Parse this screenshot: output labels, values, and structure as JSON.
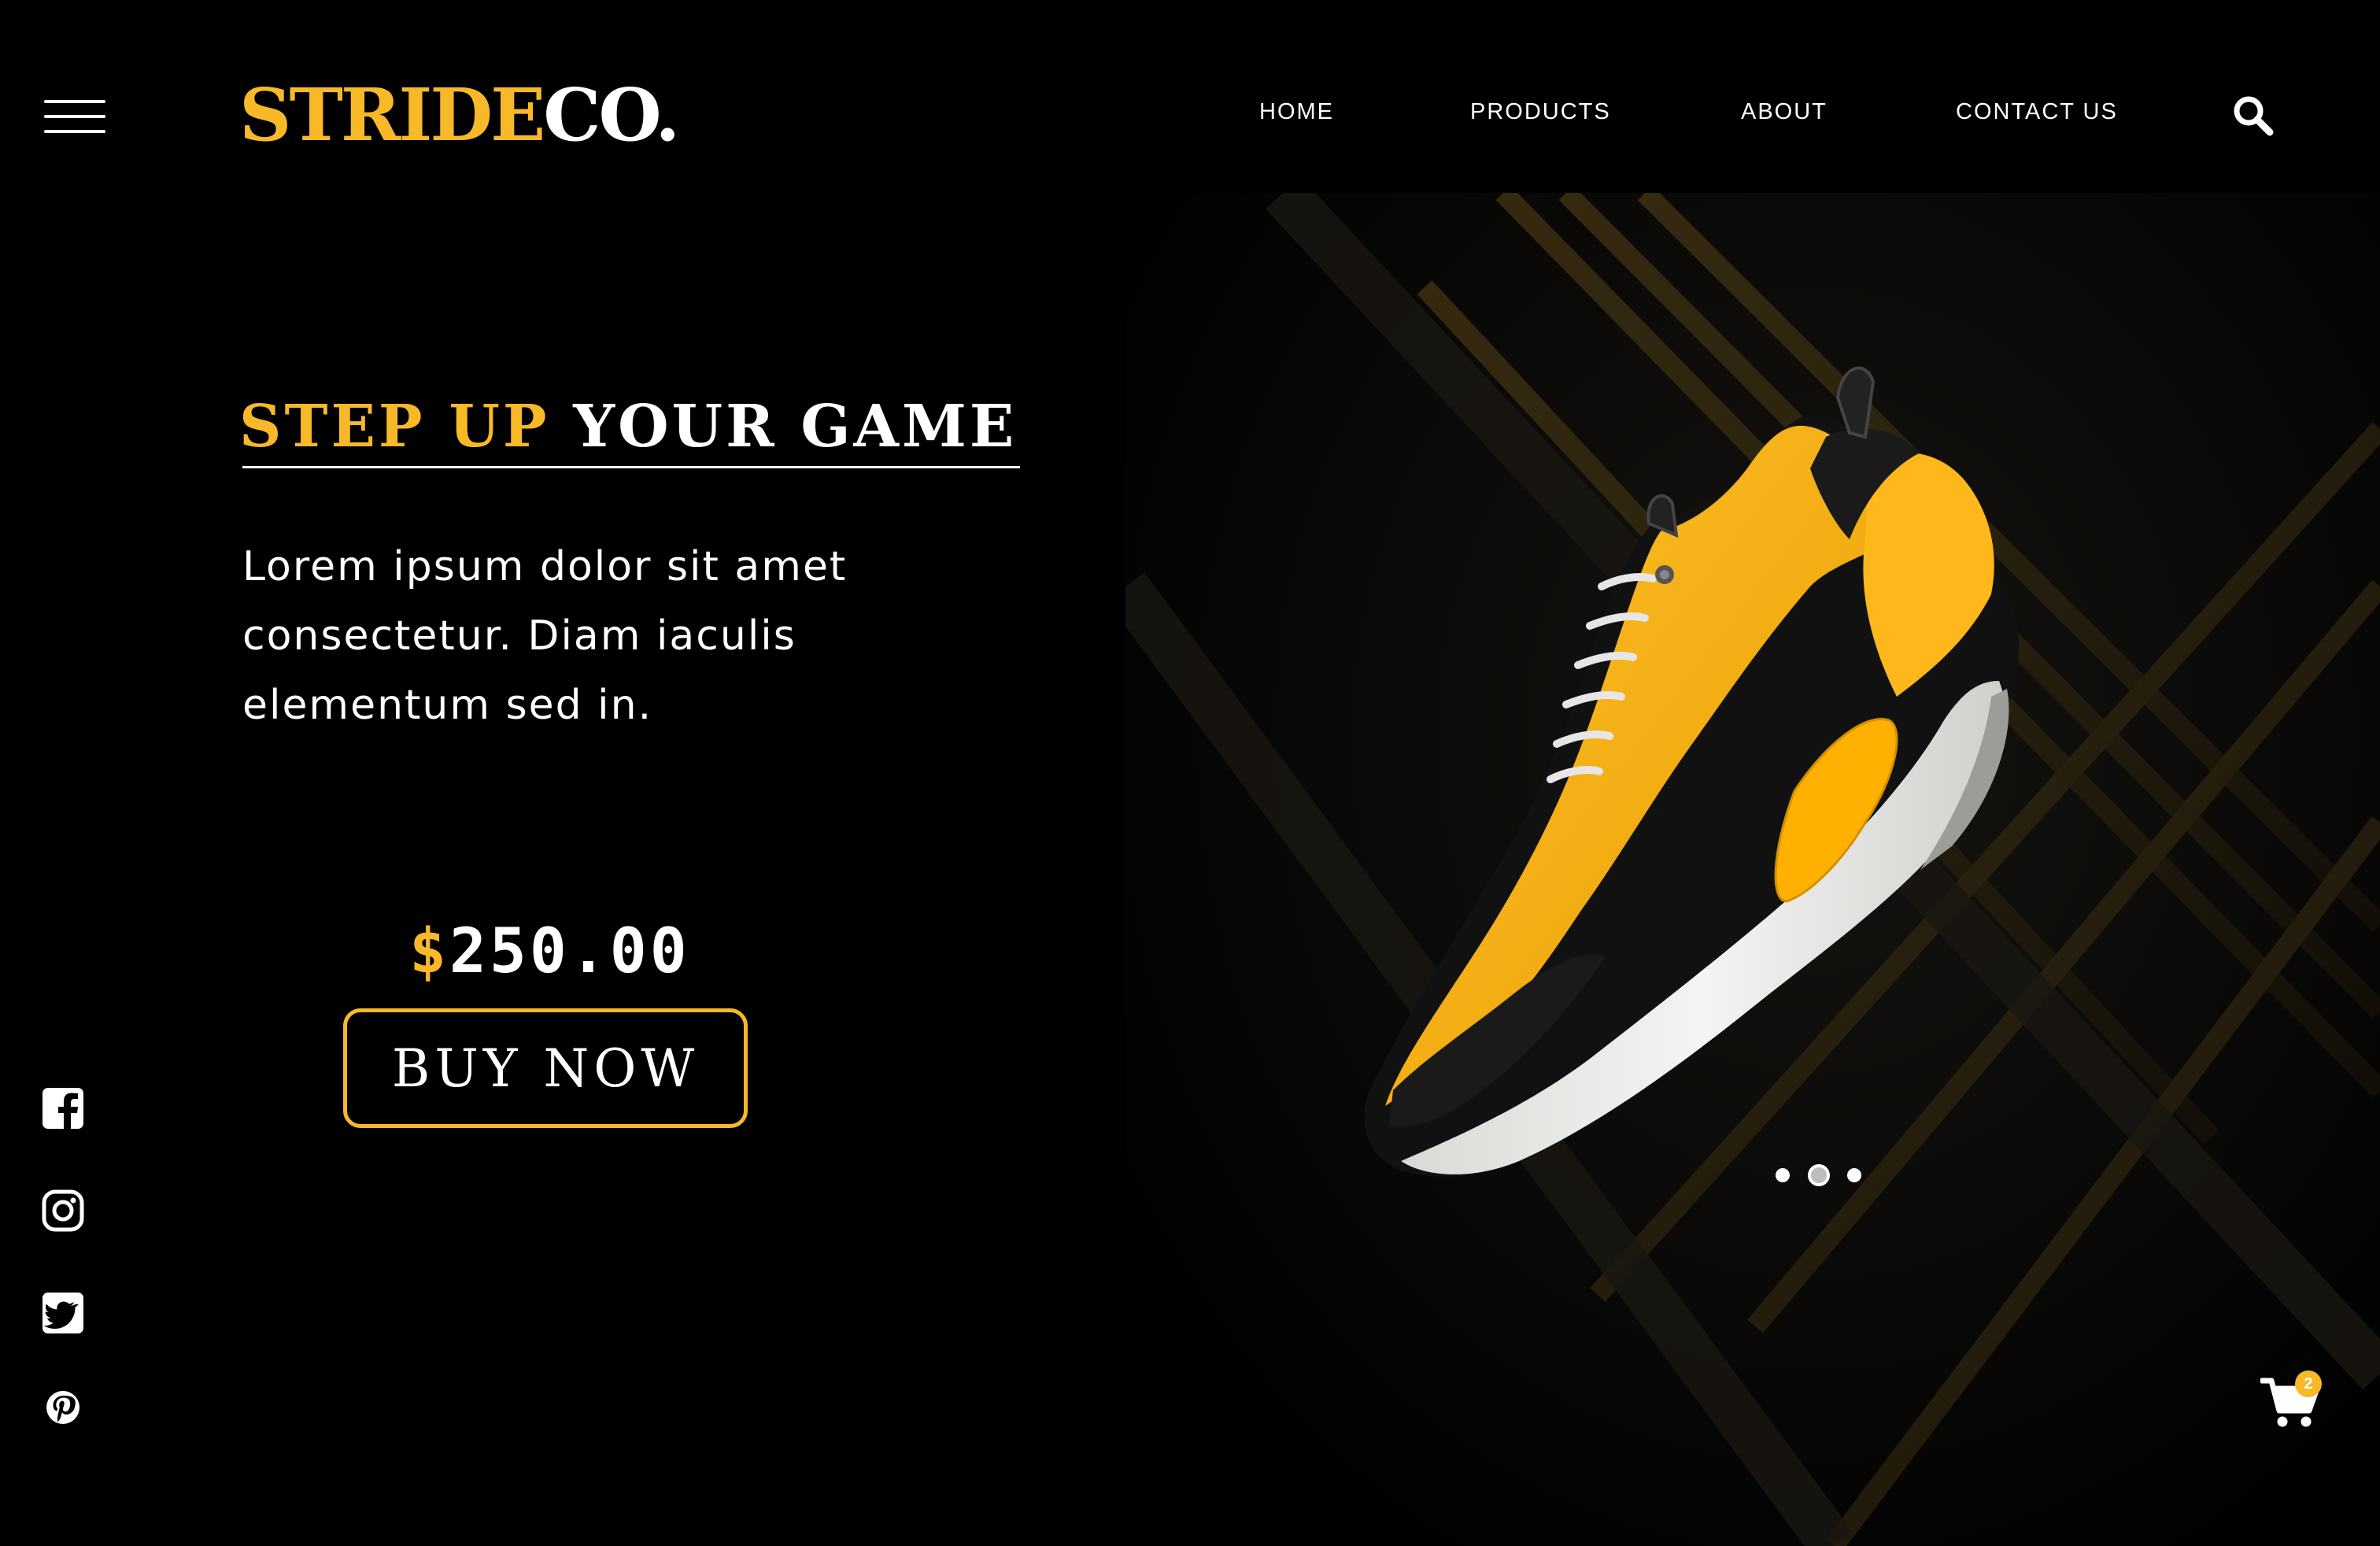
{
  "brand": {
    "name_accent": "STRIDE",
    "name_light": "CO.",
    "accent_color": "#f7b928"
  },
  "nav": {
    "items": [
      {
        "label": "HOME"
      },
      {
        "label": "PRODUCTS"
      },
      {
        "label": "ABOUT"
      },
      {
        "label": "CONTACT US"
      }
    ],
    "search_icon": "search-icon",
    "menu_icon": "hamburger-menu-icon"
  },
  "hero": {
    "headline_accent": "STEP UP",
    "headline_rest": "YOUR GAME",
    "description": "Lorem ipsum dolor sit amet consectetur. Diam iaculis elementum sed in.",
    "price_currency": "$",
    "price_amount": "250.00",
    "cta_label": "BUY NOW",
    "product_image": "yellow-black-running-sneaker"
  },
  "carousel": {
    "slide_count": 3,
    "active_slide": 2
  },
  "social": [
    "facebook-icon",
    "instagram-icon",
    "twitter-icon",
    "pinterest-icon"
  ],
  "cart": {
    "icon": "cart-icon",
    "count": "2"
  }
}
